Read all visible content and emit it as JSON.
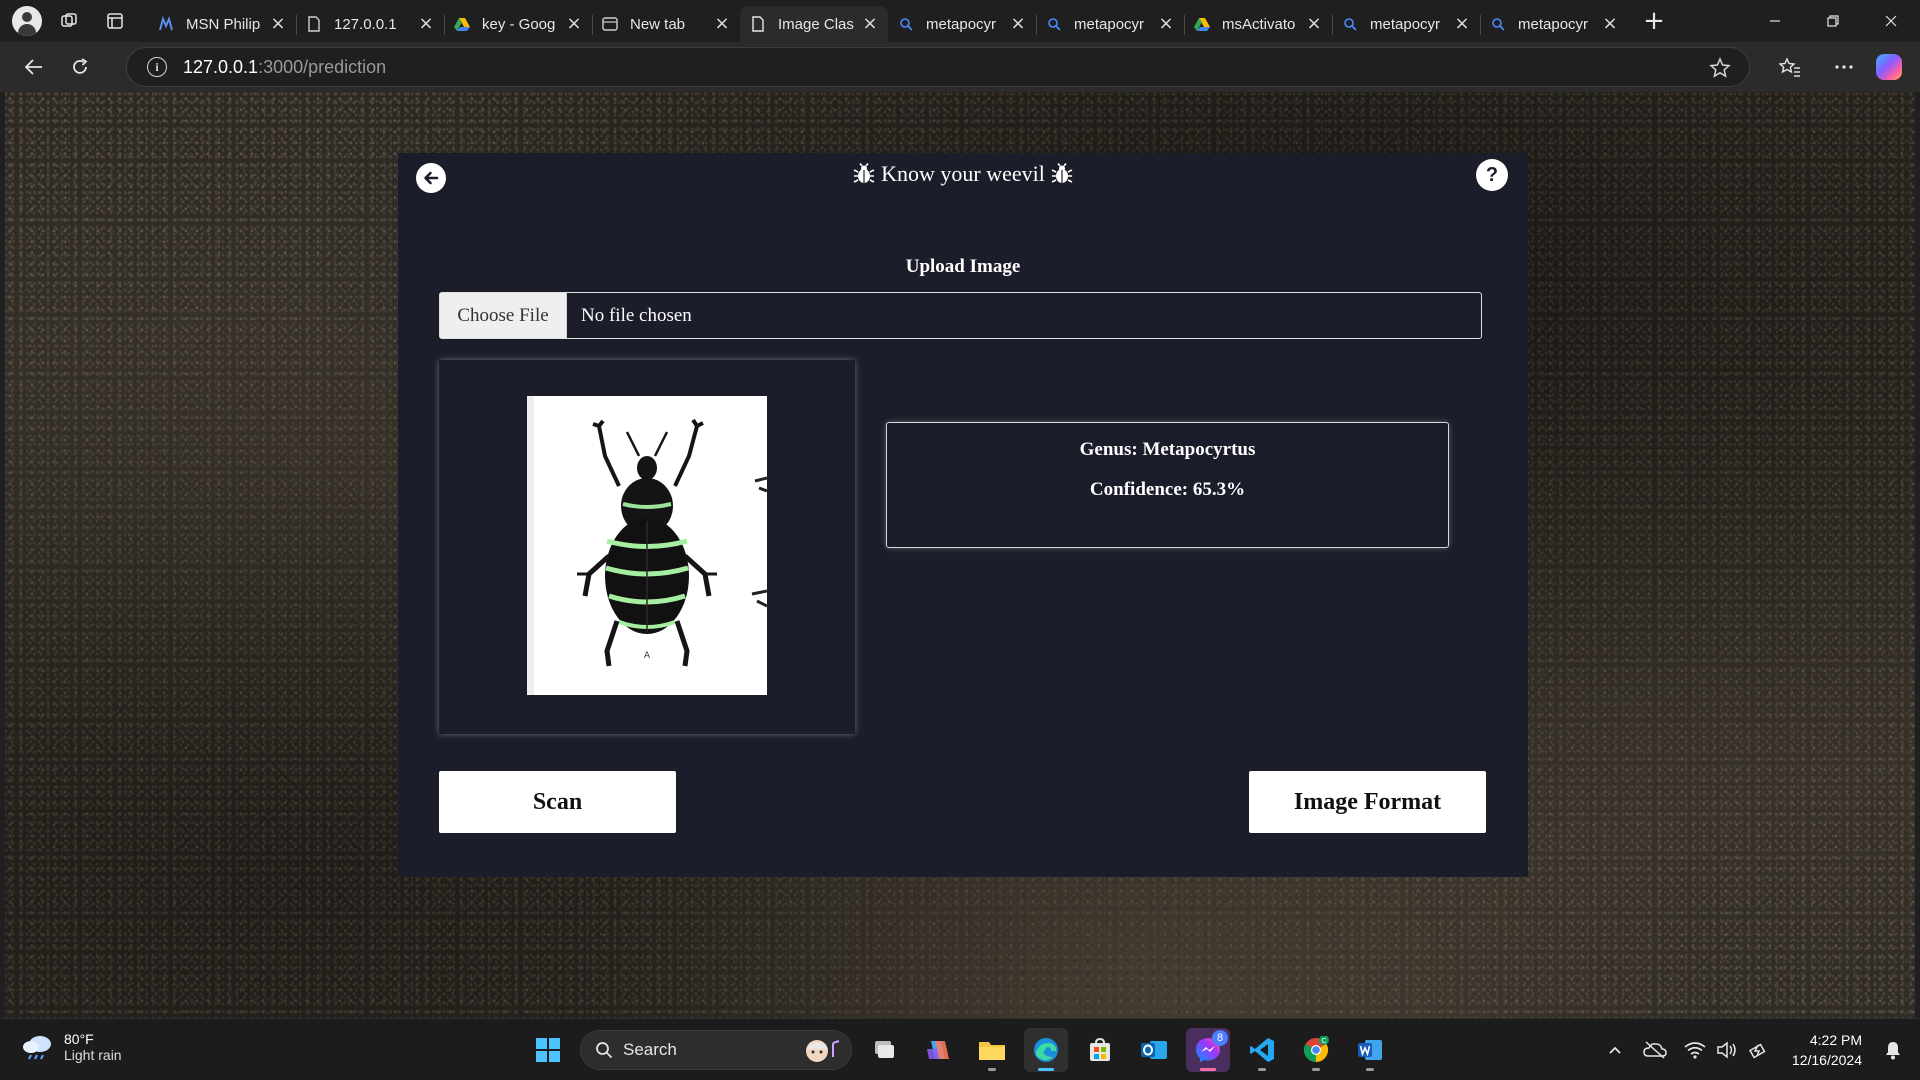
{
  "browser": {
    "tabs": [
      {
        "title": "MSN Philip",
        "icon": "msn-icon"
      },
      {
        "title": "127.0.0.1",
        "icon": "document-icon"
      },
      {
        "title": "key - Goog",
        "icon": "google-drive-icon"
      },
      {
        "title": "New tab",
        "icon": "new-tab-icon"
      },
      {
        "title": "Image Clas",
        "icon": "page-icon",
        "active": true
      },
      {
        "title": "metapocyr",
        "icon": "search-icon"
      },
      {
        "title": "metapocyr",
        "icon": "search-icon"
      },
      {
        "title": "msActivato",
        "icon": "google-drive-icon"
      },
      {
        "title": "metapocyr",
        "icon": "search-icon"
      },
      {
        "title": "metapocyr",
        "icon": "search-icon"
      }
    ],
    "url_host": "127.0.0.1",
    "url_path": ":3000/prediction"
  },
  "app": {
    "title": "Know your weevil",
    "upload_label": "Upload Image",
    "choose_file_label": "Choose File",
    "file_status": "No file chosen",
    "result_genus": "Genus: Metapocyrtus",
    "result_confidence": "Confidence: 65.3%",
    "preview_caption": "A",
    "scan_label": "Scan",
    "format_label": "Image Format",
    "help_label": "?"
  },
  "taskbar": {
    "weather_temp": "80°F",
    "weather_condition": "Light rain",
    "search_placeholder": "Search",
    "messenger_badge": "8",
    "time": "4:22 PM",
    "date": "12/16/2024"
  },
  "colors": {
    "card_background": "#1c1d2a",
    "browser_chrome": "#2b2b2b",
    "active_indicator": "#4cc2ff"
  }
}
